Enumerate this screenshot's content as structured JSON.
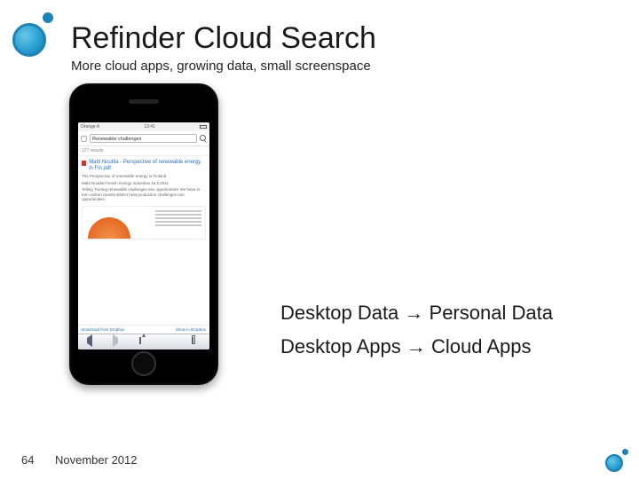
{
  "header": {
    "title": "Refinder Cloud Search",
    "subtitle": "More cloud apps, growing data, small screenspace"
  },
  "phone": {
    "statusbar": {
      "carrier": "Orange A",
      "time": "13:41"
    },
    "search": {
      "value": "Renewable challenges"
    },
    "result_count": "127 results",
    "result": {
      "title": "Matti Nuutila - Perspective of renewable energy in Fin.pdf",
      "meta1": "The Perspective of renewable energy in Finland",
      "meta2": "Matti Nuutila  Finnish Energy Industries  16.3.2011",
      "meta3": "Telling Turning renewable challenges into opportunities  We have to turn carbon neutral district heat production challenges into opportunities."
    },
    "links": {
      "left": "Download from Dropbox",
      "right": "Show in Dropbox"
    }
  },
  "trends": {
    "line1": "Desktop Data → Personal Data",
    "line2": "Desktop Apps → Cloud Apps"
  },
  "footer": {
    "page": "64",
    "date": "November 2012"
  }
}
